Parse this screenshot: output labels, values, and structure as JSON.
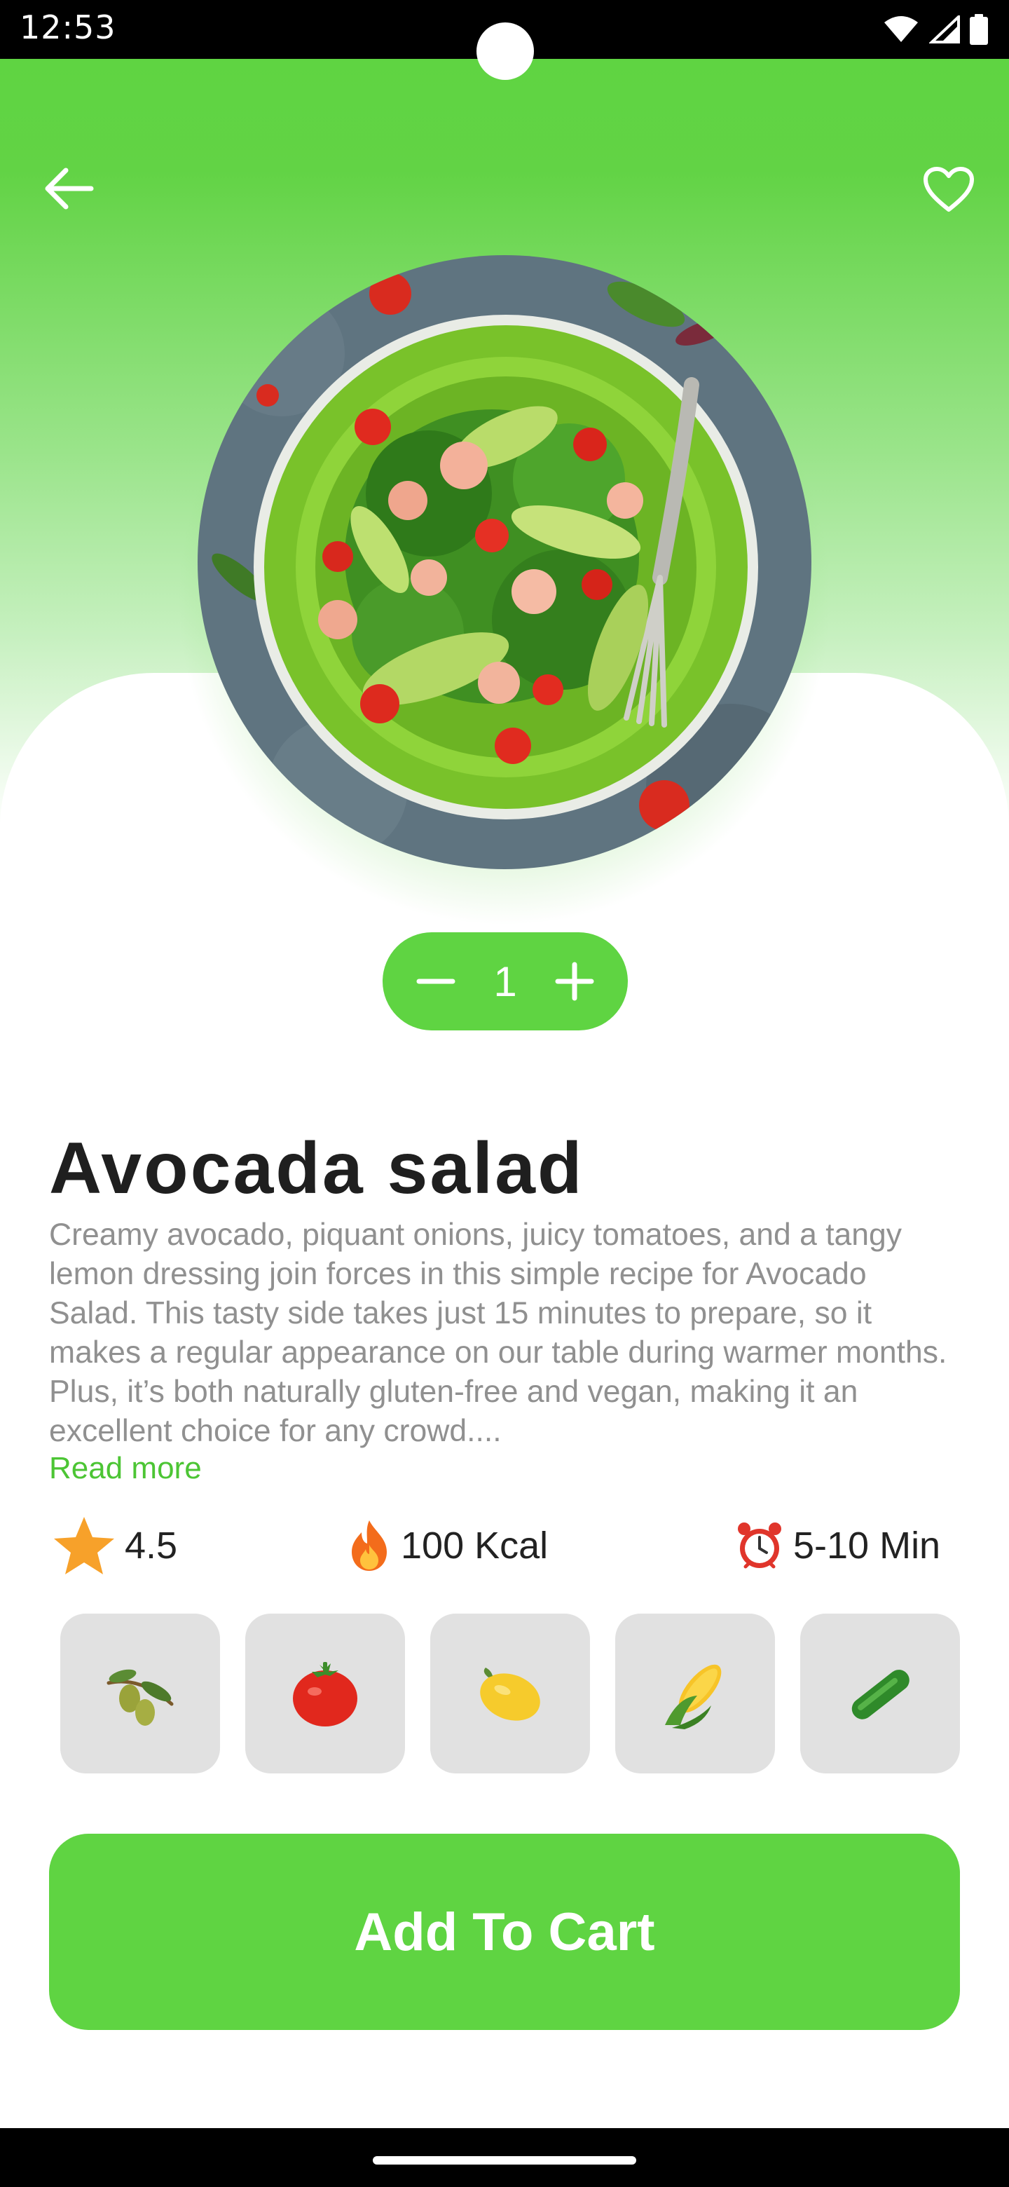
{
  "status_bar": {
    "time": "12:53",
    "icons": [
      "wifi-icon",
      "signal-icon",
      "battery-icon"
    ]
  },
  "header": {
    "back_icon": "arrow-left-icon",
    "favorite_icon": "heart-outline-icon"
  },
  "colors": {
    "accent": "#5fd442",
    "title": "#1f1f1f",
    "description": "#909090",
    "link": "#4cc534",
    "tile": "#e1e1e1"
  },
  "quantity": {
    "value": "1",
    "decrement_icon": "minus-icon",
    "increment_icon": "plus-icon"
  },
  "dish": {
    "title": "Avocada salad",
    "description": "Creamy avocado, piquant onions, juicy tomatoes, and a tangy lemon dressing join forces in this simple recipe for Avocado Salad. This tasty side takes just 15 minutes to prepare, so it makes a regular appearance on our table during warmer months. Plus, it’s both naturally gluten-free and vegan, making it an excellent choice for any crowd....",
    "read_more": "Read more"
  },
  "stats": {
    "rating": "4.5",
    "calories": "100 Kcal",
    "time": "5-10 Min"
  },
  "ingredients": [
    "olive-icon",
    "tomato-icon",
    "lemon-icon",
    "corn-icon",
    "cucumber-icon"
  ],
  "cart": {
    "label": "Add To Cart"
  }
}
